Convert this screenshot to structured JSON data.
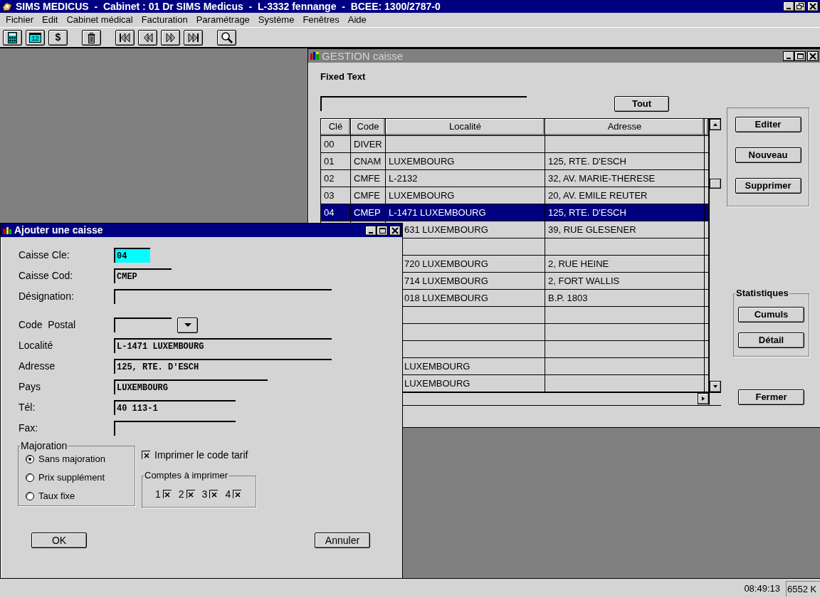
{
  "app_title_bar": {
    "title": "SIMS MEDICUS  -  Cabinet : 01 Dr SIMS Medicus  -  L-3332 fennange  -  BCEE: 1300/2787-0"
  },
  "menu": [
    "Fichier",
    "Edit",
    "Cabinet médical",
    "Facturation",
    "Paramétrage",
    "Système",
    "Fenêtres",
    "Aide"
  ],
  "toolbar": [
    [
      {
        "kind": "calculator"
      },
      {
        "kind": "calendar",
        "label": "12"
      },
      {
        "kind": "dollar",
        "label": "$"
      }
    ],
    [
      {
        "kind": "trash"
      }
    ],
    [
      {
        "kind": "first"
      },
      {
        "kind": "previous"
      },
      {
        "kind": "next"
      },
      {
        "kind": "last"
      }
    ],
    [
      {
        "kind": "search"
      }
    ]
  ],
  "gestion_window": {
    "title": "GESTION caisse",
    "active": false,
    "fixed_text": "Fixed Text",
    "filter_button": "Tout",
    "table": {
      "columns": [
        "Clé",
        "Code",
        "Localité",
        "Adresse"
      ],
      "rows": [
        {
          "cle": "00",
          "code": "DIVER",
          "selected": false
        },
        {
          "cle": "01",
          "code": "CNAM",
          "localite": "LUXEMBOURG",
          "adresse": "125, RTE. D'ESCH",
          "selected": false
        },
        {
          "cle": "02",
          "code": "CMFE",
          "localite": "L-2132",
          "adresse": "32, AV. MARIE-THERESE",
          "selected": false
        },
        {
          "cle": "03",
          "code": "CMFE",
          "localite": "LUXEMBOURG",
          "adresse": "20, AV. EMILE REUTER",
          "selected": false
        },
        {
          "cle": "04",
          "code": "CMEP",
          "localite": "L-1471 LUXEMBOURG",
          "adresse": "125, RTE. D'ESCH",
          "selected": true
        },
        {
          "localite": "631 LUXEMBOURG",
          "adresse": "39, RUE GLESENER",
          "selected": false
        },
        {
          "selected": false
        },
        {
          "localite": "720 LUXEMBOURG",
          "adresse": "2, RUE HEINE",
          "selected": false
        },
        {
          "localite": "714 LUXEMBOURG",
          "adresse": "2, FORT WALLIS",
          "selected": false
        },
        {
          "localite": "018 LUXEMBOURG",
          "adresse": "B.P. 1803",
          "selected": false
        },
        {
          "selected": false
        },
        {
          "selected": false
        },
        {
          "selected": false
        },
        {
          "localite": "LUXEMBOURG",
          "selected": false
        },
        {
          "localite": "LUXEMBOURG",
          "selected": false
        }
      ]
    },
    "actions": [
      "Editer",
      "Nouveau",
      "Supprimer"
    ],
    "statistics": {
      "title": "Statistiques",
      "buttons": [
        "Cumuls",
        "Détail"
      ]
    },
    "close_button": "Fermer"
  },
  "dialog": {
    "title": "Ajouter une caisse",
    "active": true,
    "fields": [
      {
        "label": "Caisse Cle:",
        "value": "04",
        "kind": "key"
      },
      {
        "label": "Caisse Cod:",
        "value": "CMEP",
        "kind": "text"
      },
      {
        "label": "Désignation:",
        "kind": "text"
      },
      {
        "label": "Code  Postal",
        "kind": "combo"
      },
      {
        "label": "Localité",
        "value": "L-1471 LUXEMBOURG",
        "kind": "text"
      },
      {
        "label": "Adresse",
        "value": "125, RTE. D'ESCH",
        "kind": "text"
      },
      {
        "label": "Pays",
        "value": "LUXEMBOURG",
        "kind": "text"
      },
      {
        "label": "Tél:",
        "value": "40 113-1",
        "kind": "text"
      },
      {
        "label": "Fax:",
        "kind": "text"
      }
    ],
    "majoration": {
      "title": "Majoration",
      "options": [
        {
          "label": "Sans majoration",
          "selected": true
        },
        {
          "label": "Prix supplément",
          "selected": false
        },
        {
          "label": "Taux fixe",
          "selected": false
        }
      ]
    },
    "print_tariff_code": {
      "label": "Imprimer le code tarif",
      "checked": true
    },
    "accounts": {
      "title": "Comptes à imprimer",
      "items": [
        {
          "label": "1",
          "checked": true
        },
        {
          "label": "2",
          "checked": true
        },
        {
          "label": "3",
          "checked": true
        },
        {
          "label": "4",
          "checked": true
        }
      ]
    },
    "buttons": [
      "OK",
      "Annuler"
    ]
  },
  "status_bar": {
    "time": "08:49:13",
    "memory": "6552 K"
  }
}
